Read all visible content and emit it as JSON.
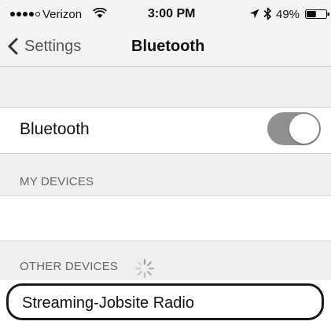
{
  "status_bar": {
    "signal_dots": [
      true,
      true,
      true,
      true,
      false
    ],
    "carrier": "Verizon",
    "wifi_icon": "wifi-icon",
    "time": "3:00 PM",
    "location_icon": "location-arrow-icon",
    "bluetooth_icon": "bluetooth-icon",
    "battery_percent": "49%",
    "battery_level": 0.49
  },
  "nav": {
    "back_label": "Settings",
    "back_icon": "chevron-left-icon",
    "title": "Bluetooth"
  },
  "bluetooth_toggle": {
    "label": "Bluetooth",
    "enabled": true
  },
  "sections": {
    "my_devices_header": "MY DEVICES",
    "other_devices_header": "OTHER DEVICES",
    "scanning_icon": "spinner-icon"
  },
  "other_devices": [
    {
      "name": "Streaming-Jobsite Radio",
      "highlighted": true
    }
  ],
  "colors": {
    "toggle_on": "#8f8f8f",
    "group_background": "#efeff2",
    "highlight_border": "#1a1a1a"
  }
}
